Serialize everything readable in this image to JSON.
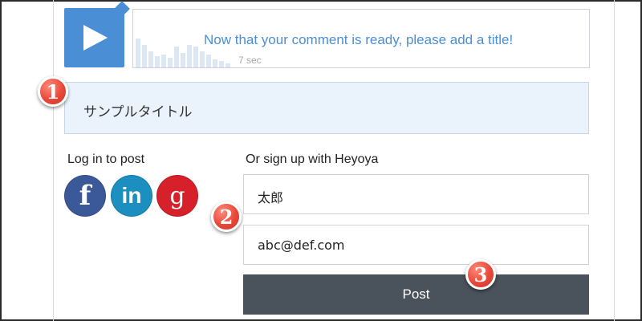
{
  "recording": {
    "prompt": "Now that your comment is ready, please add a title!",
    "duration": "7 sec",
    "play_icon": "play-icon"
  },
  "title_input": {
    "value": "サンプルタイトル"
  },
  "login": {
    "label": "Log in to post",
    "providers": [
      {
        "name": "facebook-icon",
        "glyph": "f"
      },
      {
        "name": "linkedin-icon",
        "glyph": "in"
      },
      {
        "name": "google-icon",
        "glyph": "g"
      }
    ]
  },
  "signup": {
    "label": "Or sign up with Heyoya",
    "name_value": "太郎",
    "email_value": "abc@def.com",
    "post_label": "Post"
  },
  "callouts": [
    "1",
    "2",
    "3"
  ],
  "colors": {
    "accent": "#4a8fd6",
    "title_bg": "#eaf2fc",
    "post_button": "#4a525b",
    "callout": "#e8483a",
    "facebook": "#3b5998",
    "linkedin": "#1a8fc0",
    "google": "#d6212b"
  }
}
